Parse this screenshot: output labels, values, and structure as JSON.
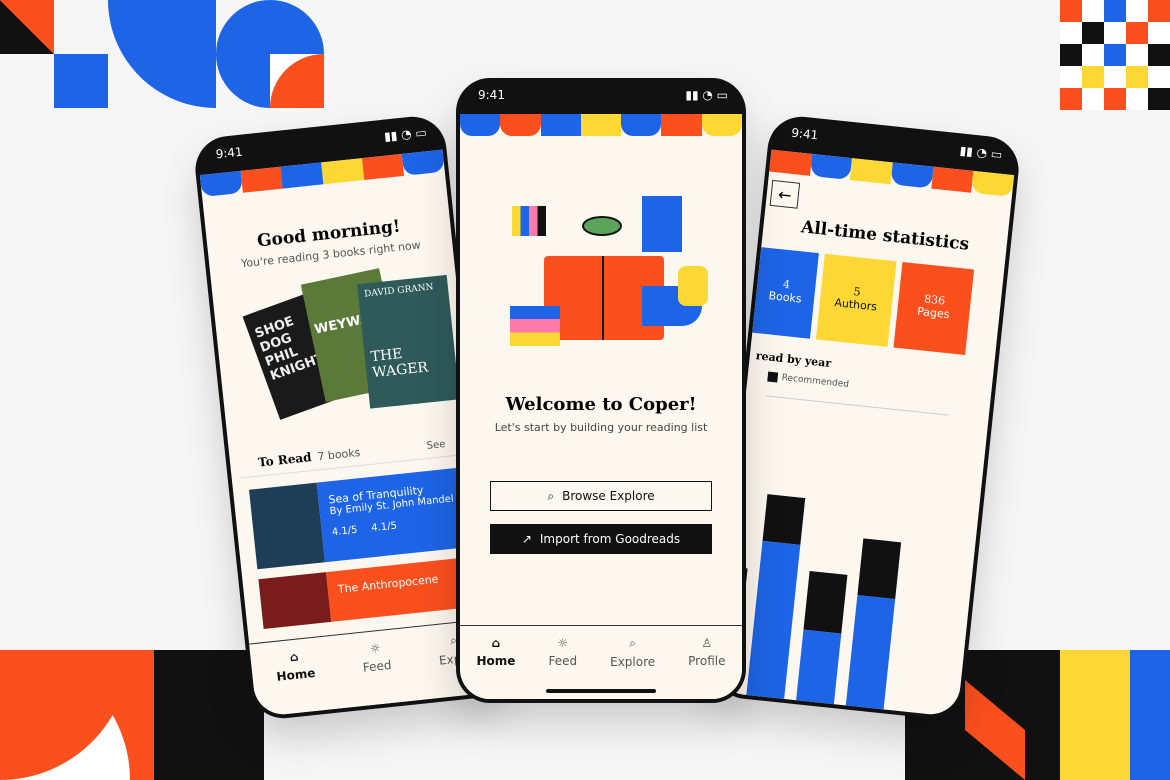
{
  "colors": {
    "blue": "#1d64e6",
    "orange": "#fb4f1e",
    "yellow": "#fdd835",
    "black": "#111111",
    "cream": "#fdf8ef"
  },
  "status_time": "9:41",
  "home_screen": {
    "greeting": "Good morning!",
    "subtitle": "You're reading 3 books right now",
    "covers": [
      "SHOE DOG PHIL KNIGHT",
      "WEYWARD",
      "THE WAGER"
    ],
    "cover_author": "DAVID GRANN",
    "to_read_label": "To Read",
    "to_read_count": "7 books",
    "see_all": "See",
    "books": [
      {
        "title": "Sea of Tranquility",
        "author": "By Emily St. John Mandel",
        "rating1": "4.1/5",
        "rating2": "4.1/5"
      },
      {
        "title": "The Anthropocene"
      }
    ]
  },
  "welcome_screen": {
    "title": "Welcome to Coper!",
    "subtitle": "Let's start by building your reading list",
    "browse_button": "Browse Explore",
    "import_button": "Import from Goodreads"
  },
  "tabs": [
    {
      "label": "Home",
      "icon": "home-icon"
    },
    {
      "label": "Feed",
      "icon": "sun-icon"
    },
    {
      "label": "Explore",
      "icon": "search-icon"
    },
    {
      "label": "Profile",
      "icon": "user-icon"
    }
  ],
  "left_tabs": [
    "Home",
    "Feed",
    "Explo"
  ],
  "stats_screen": {
    "title": "All-time statistics",
    "cards": [
      {
        "value": "4",
        "label": "Books"
      },
      {
        "value": "5",
        "label": "Authors"
      },
      {
        "value": "836",
        "label": "Pages"
      }
    ],
    "section": "read by year",
    "legend": "Recommended",
    "bars": [
      {
        "total": 0.6,
        "recommended": 0.12
      },
      {
        "total": 0.96,
        "recommended": 0.22
      },
      {
        "total": 0.62,
        "recommended": 0.28
      },
      {
        "total": 0.8,
        "recommended": 0.27
      }
    ]
  }
}
